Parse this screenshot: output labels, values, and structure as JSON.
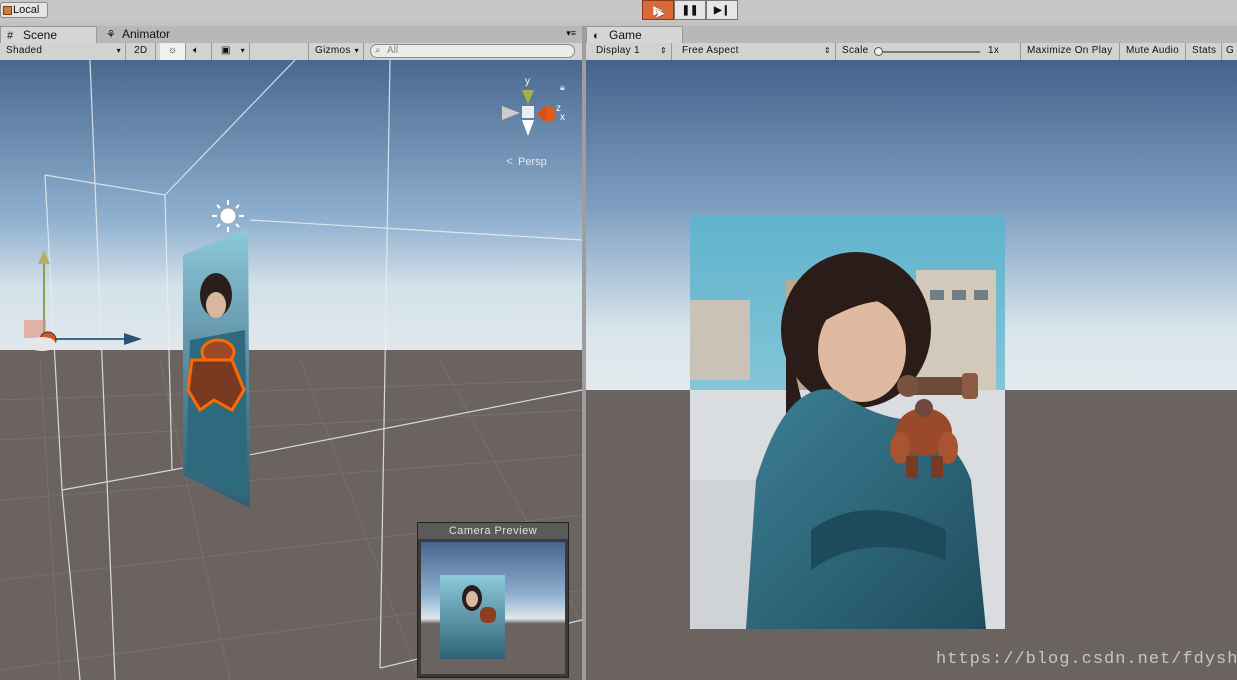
{
  "toolbar": {
    "local_label": "Local",
    "play_icon": "▶",
    "pause_icon": "❚❚",
    "step_icon": "▶❙"
  },
  "scene_panel": {
    "tabs": [
      {
        "label": "Scene",
        "icon": "grid-icon"
      },
      {
        "label": "Animator",
        "icon": "animator-icon"
      }
    ],
    "shading_mode": "Shaded",
    "mode_2d_label": "2D",
    "gizmos_label": "Gizmos",
    "search_placeholder": "All",
    "gizmo_axes": {
      "y": "y",
      "z": "z",
      "x": "x"
    },
    "projection_label": "Persp",
    "camera_preview_title": "Camera Preview"
  },
  "game_panel": {
    "tab_label": "Game",
    "display": "Display 1",
    "aspect": "Free Aspect",
    "scale_label": "Scale",
    "scale_value": "1x",
    "scale_fraction": 0.0,
    "maximize_label": "Maximize On Play",
    "mute_label": "Mute Audio",
    "stats_label": "Stats",
    "gizmos_label_cut": "G"
  },
  "watermark": "https://blog.csdn.net/fdyshlk",
  "colors": {
    "sky_top": "#46658e",
    "sky_horizon": "#d6e4ec",
    "ground": "#6b6360",
    "selection_orange": "#ff6a00",
    "play_active": "#d86a3a"
  }
}
